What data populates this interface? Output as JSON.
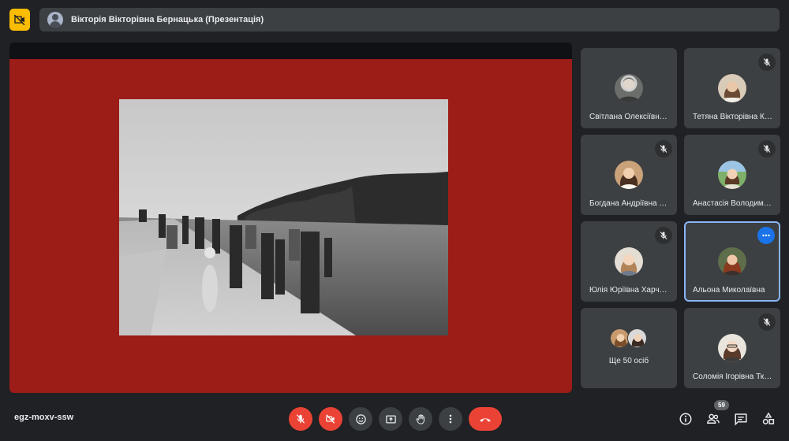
{
  "topbar": {
    "presenter_label": "Вікторія Вікторівна Бернацька (Презентація)"
  },
  "participants": [
    {
      "name": "Світлана Олексіївна Гончаренко",
      "muted": false
    },
    {
      "name": "Тетяна Вікторівна Кравченко",
      "muted": true
    },
    {
      "name": "Богдана Андріївна Коваль",
      "muted": true
    },
    {
      "name": "Анастасія Володимирівна",
      "muted": true
    },
    {
      "name": "Юлія Юріївна Харченко",
      "muted": true
    },
    {
      "name": "Альона Миколаївна",
      "muted": false,
      "active": true
    },
    {
      "name": "Соломія Ігорівна Ткаченко",
      "muted": true
    }
  ],
  "others": {
    "label": "Ще 50 осіб"
  },
  "bottombar": {
    "meeting_code": "egz-moxv-ssw",
    "participant_count": "59"
  },
  "colors": {
    "slide_background": "#9c1c18",
    "danger": "#ea4335",
    "accent": "#1a73e8",
    "warning": "#fbbc04",
    "tile": "#3c4043",
    "background": "#202124"
  },
  "icons": {
    "no_video": "video-off-icon",
    "mic": "mic-off-icon",
    "camera": "videocam-off-icon",
    "reactions": "emoji-icon",
    "present": "present-screen-icon",
    "raise_hand": "hand-icon",
    "more": "more-vert-icon",
    "end_call": "call-end-icon",
    "info": "info-icon",
    "people": "people-icon",
    "chat": "chat-icon",
    "activities": "activities-icon"
  }
}
